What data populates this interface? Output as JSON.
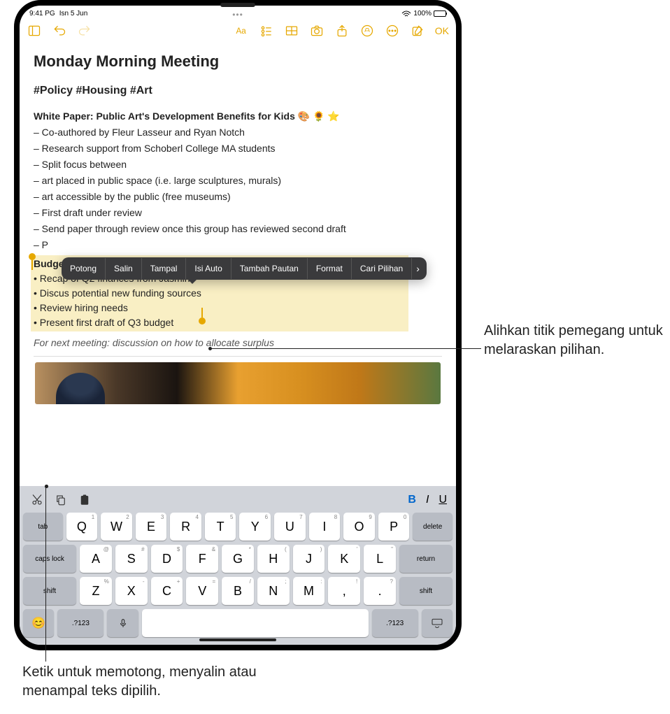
{
  "status": {
    "time": "9:41 PG",
    "date": "Isn 5 Jun",
    "battery": "100%"
  },
  "toolbar": {
    "ok": "OK"
  },
  "note": {
    "title": "Monday Morning Meeting",
    "tags": "#Policy #Housing #Art",
    "section1_title": "White Paper: Public Art's Development Benefits for Kids 🎨 🌻 ⭐",
    "lines": [
      "– Co-authored by Fleur Lasseur and Ryan Notch",
      "– Research support from Schoberl College MA students",
      "– Split focus between",
      "– art placed in public space (i.e. large sculptures, murals)",
      "– art accessible by the public (free museums)",
      "– First draft under review",
      "– Send paper through review once this group has reviewed second draft",
      "– P"
    ],
    "selection": {
      "title": "Budget check-in",
      "items": [
        "• Recap of Q2 finances from Jasmine",
        "• Discus potential new funding sources",
        "• Review hiring needs",
        "• Present first draft of Q3 budget"
      ]
    },
    "footer": "For next meeting: discussion on how to allocate surplus"
  },
  "context_menu": {
    "items": [
      "Potong",
      "Salin",
      "Tampal",
      "Isi Auto",
      "Tambah Pautan",
      "Format",
      "Cari Pilihan"
    ],
    "arrow": "›"
  },
  "keyboard": {
    "format": {
      "b": "B",
      "i": "I",
      "u": "U"
    },
    "row1_subs": [
      "1",
      "2",
      "3",
      "4",
      "5",
      "6",
      "7",
      "8",
      "9",
      "0"
    ],
    "row1": [
      "Q",
      "W",
      "E",
      "R",
      "T",
      "Y",
      "U",
      "I",
      "O",
      "P"
    ],
    "row2_subs": [
      "@",
      "#",
      "$",
      "&",
      "*",
      "(",
      ")",
      "'",
      "\""
    ],
    "row2": [
      "A",
      "S",
      "D",
      "F",
      "G",
      "H",
      "J",
      "K",
      "L"
    ],
    "row3_subs": [
      "%",
      "-",
      "+",
      "=",
      "/",
      ";",
      ":",
      "!",
      "?"
    ],
    "row3": [
      "Z",
      "X",
      "C",
      "V",
      "B",
      "N",
      "M",
      ",",
      "."
    ],
    "tab": "tab",
    "delete": "delete",
    "caps": "caps lock",
    "return": "return",
    "shift": "shift",
    "numkey": ".?123"
  },
  "callouts": {
    "right": "Alihkan titik pemegang untuk melaraskan pilihan.",
    "bottom": "Ketik untuk memotong, menyalin atau menampal teks dipilih."
  }
}
